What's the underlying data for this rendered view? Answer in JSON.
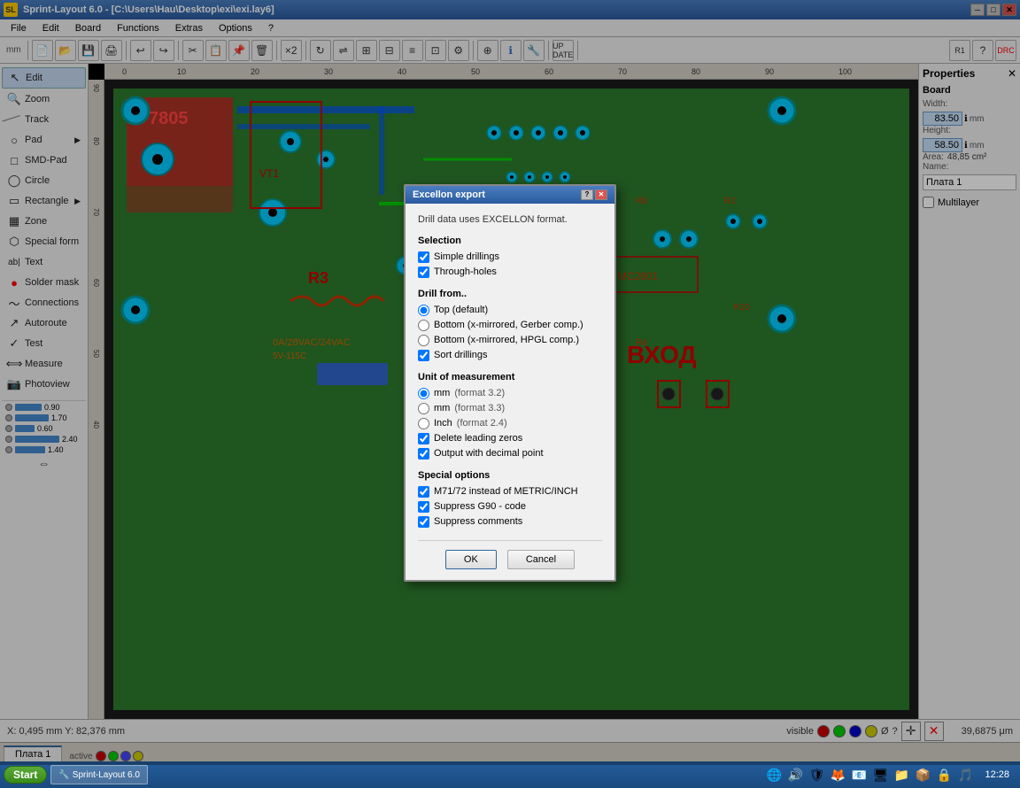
{
  "titleBar": {
    "title": "Sprint-Layout 6.0 - [C:\\Users\\Hau\\Desktop\\exi\\exi.lay6]",
    "minBtn": "─",
    "maxBtn": "□",
    "closeBtn": "✕"
  },
  "menuBar": {
    "items": [
      "File",
      "Edit",
      "Board",
      "Functions",
      "Extras",
      "Options",
      "?"
    ]
  },
  "leftToolbar": {
    "items": [
      {
        "id": "edit",
        "label": "Edit",
        "icon": "↖",
        "active": true
      },
      {
        "id": "zoom",
        "label": "Zoom",
        "icon": "🔍"
      },
      {
        "id": "track",
        "label": "Track",
        "icon": "/"
      },
      {
        "id": "pad",
        "label": "Pad",
        "icon": "○",
        "hasArrow": true
      },
      {
        "id": "smd-pad",
        "label": "SMD-Pad",
        "icon": "□"
      },
      {
        "id": "circle",
        "label": "Circle",
        "icon": "◯"
      },
      {
        "id": "rectangle",
        "label": "Rectangle",
        "icon": "▭",
        "hasArrow": true
      },
      {
        "id": "zone",
        "label": "Zone",
        "icon": "▦"
      },
      {
        "id": "special-form",
        "label": "Special form",
        "icon": "⬡"
      },
      {
        "id": "text",
        "label": "Text",
        "icon": "ab|"
      },
      {
        "id": "solder-mask",
        "label": "Solder mask",
        "icon": "●"
      },
      {
        "id": "connections",
        "label": "Connections",
        "icon": "~"
      },
      {
        "id": "autoroute",
        "label": "Autoroute",
        "icon": "↗"
      },
      {
        "id": "test",
        "label": "Test",
        "icon": "✓"
      },
      {
        "id": "measure",
        "label": "Measure",
        "icon": "⟺"
      },
      {
        "id": "photoview",
        "label": "Photoview",
        "icon": "📷"
      }
    ]
  },
  "statusBar": {
    "coords": "X:  0,495 mm   Y:  82,376 mm",
    "gridSize": "39,6875 μm"
  },
  "rightPanel": {
    "title": "Properties",
    "sectionBoard": "Board",
    "widthLabel": "Width:",
    "widthValue": "83.50",
    "widthUnit": "mm",
    "heightLabel": "Height:",
    "heightValue": "58.50",
    "heightUnit": "mm",
    "areaLabel": "Area:",
    "areaValue": "48,85 cm²",
    "nameLabel": "Name:",
    "nameValue": "Плата 1",
    "multilayerLabel": "Multilayer"
  },
  "bottomTabs": [
    {
      "label": "Плата 1",
      "active": true
    }
  ],
  "dialog": {
    "title": "Excellon export",
    "helpBtn": "?",
    "closeBtn": "✕",
    "description": "Drill data uses EXCELLON format.",
    "selectionTitle": "Selection",
    "checkboxes": {
      "simpleDrillings": {
        "label": "Simple drillings",
        "checked": true
      },
      "throughHoles": {
        "label": "Through-holes",
        "checked": true
      }
    },
    "drillFromTitle": "Drill from..",
    "radioGroups": {
      "drillFrom": [
        {
          "id": "top",
          "label": "Top (default)",
          "checked": true
        },
        {
          "id": "bottom-mirror-gerber",
          "label": "Bottom (x-mirrored, Gerber comp.)",
          "checked": false
        },
        {
          "id": "bottom-mirror-hpgl",
          "label": "Bottom (x-mirrored, HPGL comp.)",
          "checked": false
        }
      ]
    },
    "sortDrillings": {
      "label": "Sort drillings",
      "checked": true
    },
    "unitTitle": "Unit of measurement",
    "units": [
      {
        "id": "mm-32",
        "label": "mm",
        "format": "(format 3.2)",
        "checked": true
      },
      {
        "id": "mm-33",
        "label": "mm",
        "format": "(format 3.3)",
        "checked": false
      },
      {
        "id": "inch-24",
        "label": "Inch",
        "format": "(format 2.4)",
        "checked": false
      }
    ],
    "deleteLeadingZeros": {
      "label": "Delete leading zeros",
      "checked": true
    },
    "outputDecimalPoint": {
      "label": "Output with decimal point",
      "checked": true
    },
    "specialOptionsTitle": "Special options",
    "specialOptions": [
      {
        "id": "m71",
        "label": "M71/72 instead of METRIC/INCH",
        "checked": true
      },
      {
        "id": "suppress-g90",
        "label": "Suppress G90 - code",
        "checked": true
      },
      {
        "id": "suppress-comments",
        "label": "Suppress comments",
        "checked": true
      }
    ],
    "okLabel": "OK",
    "cancelLabel": "Cancel"
  },
  "taskbar": {
    "startLabel": "Start",
    "time": "12:28",
    "apps": [
      "🔵",
      "🌐",
      "📧",
      "🖥",
      "📁",
      "📦",
      "🔒",
      "🎵"
    ],
    "activeApp": "Sprint-Layout 6.0",
    "statusLabel": "active"
  },
  "layerBar": {
    "visible": "visible",
    "active": "active",
    "layers": [
      {
        "id": "C1",
        "color": "#cc0000"
      },
      {
        "id": "S1",
        "color": "#00cc00"
      },
      {
        "id": "C2",
        "color": "#0000cc"
      },
      {
        "id": "S2",
        "color": "#cccc00"
      },
      {
        "id": "drill",
        "symbol": "Ø",
        "color": "#ffffff"
      }
    ]
  },
  "dimControls": [
    {
      "value": "0.90"
    },
    {
      "value": "1.70"
    },
    {
      "value": "0.60"
    },
    {
      "value": "2.40"
    },
    {
      "value": "1.40"
    }
  ]
}
